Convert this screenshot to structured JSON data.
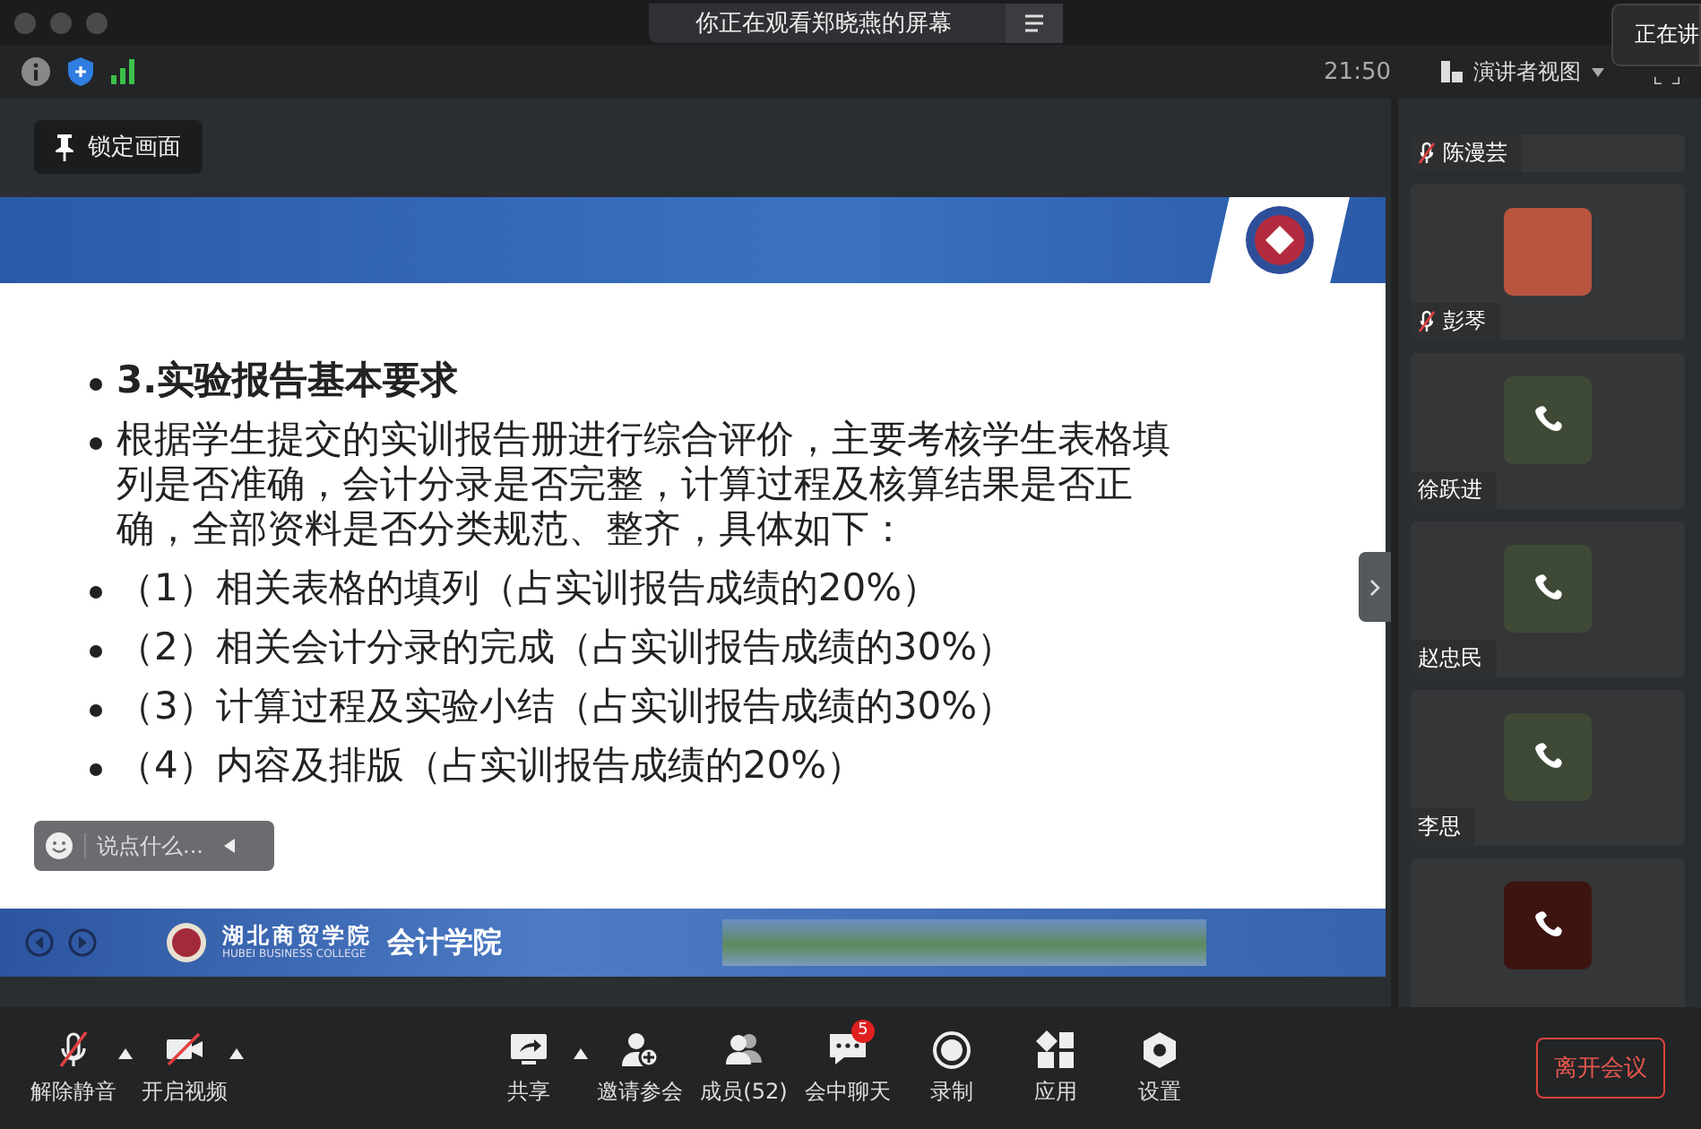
{
  "window": {
    "title": "你正在观看郑晓燕的屏幕",
    "tooltip": "正在讲"
  },
  "toolbar": {
    "time": "21:50",
    "view_menu": "演讲者视图"
  },
  "lock_button": "锁定画面",
  "slide": {
    "items": [
      {
        "kind": "heading",
        "text": "3.实验报告基本要求"
      },
      {
        "kind": "bullet",
        "text": "根据学生提交的实训报告册进行综合评价，主要考核学生表格填列是否准确，会计分录是否完整，计算过程及核算结果是否正确，全部资料是否分类规范、整齐，具体如下："
      },
      {
        "kind": "bullet",
        "text": "（1）相关表格的填列（占实训报告成绩的20%）"
      },
      {
        "kind": "bullet",
        "text": "（2）相关会计分录的完成（占实训报告成绩的30%）"
      },
      {
        "kind": "bullet",
        "text": "（3）计算过程及实验小结（占实训报告成绩的30%）"
      },
      {
        "kind": "bullet",
        "text": "（4）内容及排版（占实训报告成绩的20%）"
      }
    ],
    "banner": {
      "school": "湖北商贸学院",
      "school_en": "HUBEI BUSINESS COLLEGE",
      "department": "会计学院"
    }
  },
  "chat_input": {
    "placeholder": "说点什么..."
  },
  "participants": [
    {
      "kind": "name-only",
      "name": "陈漫芸",
      "muted": true
    },
    {
      "kind": "photo",
      "name": "彭琴",
      "muted": true
    },
    {
      "kind": "call",
      "name": "徐跃进",
      "muted": false
    },
    {
      "kind": "call",
      "name": "赵忠民",
      "muted": false
    },
    {
      "kind": "call",
      "name": "李思",
      "muted": false
    },
    {
      "kind": "call-dark"
    }
  ],
  "av_controls": [
    {
      "label": "解除静音",
      "dropdown": true
    },
    {
      "label": "开启视频",
      "dropdown": true
    }
  ],
  "meeting_controls": [
    {
      "label": "共享",
      "dropdown": true
    },
    {
      "label": "邀请参会",
      "dropdown": false
    },
    {
      "label": "成员(52)",
      "dropdown": false
    },
    {
      "label": "会中聊天",
      "dropdown": false,
      "badge": "5"
    },
    {
      "label": "录制",
      "dropdown": false
    },
    {
      "label": "应用",
      "dropdown": false
    },
    {
      "label": "设置",
      "dropdown": false
    }
  ],
  "leave_button": "离开会议"
}
